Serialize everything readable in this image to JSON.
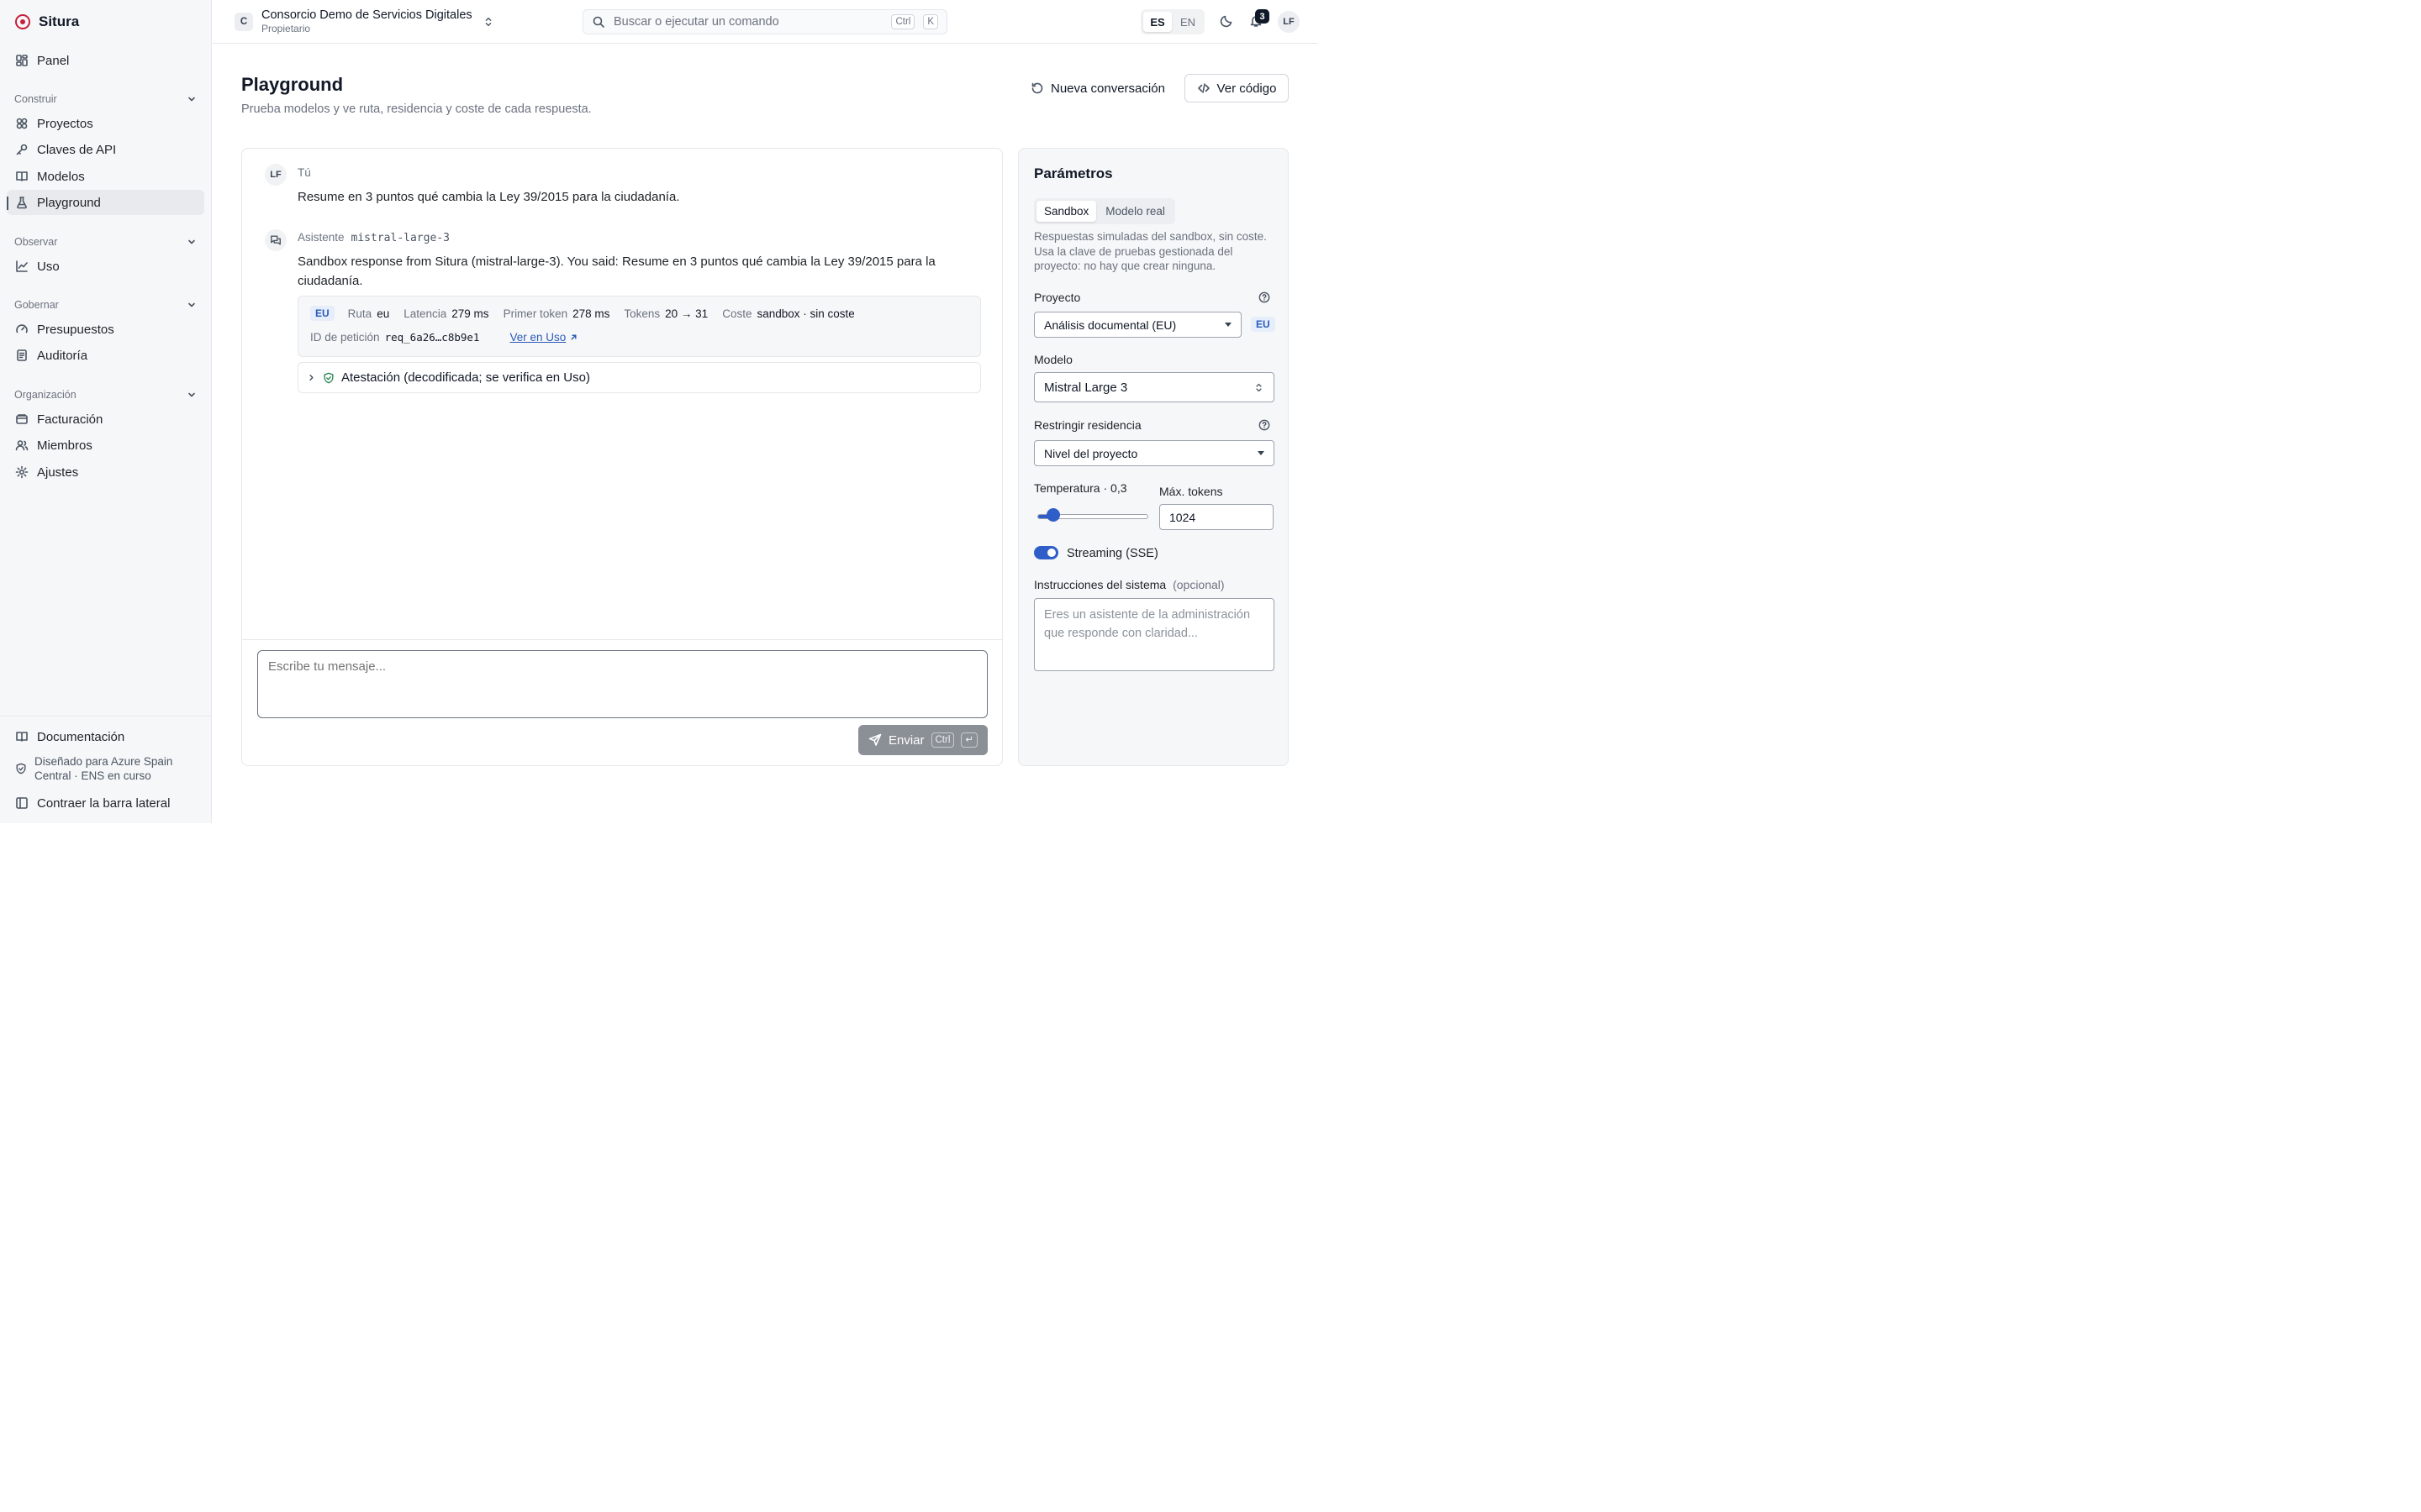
{
  "app": {
    "brand": "Situra"
  },
  "sidebar": {
    "top_item": "Panel",
    "sections": [
      {
        "title": "Construir",
        "items": [
          "Proyectos",
          "Claves de API",
          "Modelos",
          "Playground"
        ]
      },
      {
        "title": "Observar",
        "items": [
          "Uso"
        ]
      },
      {
        "title": "Gobernar",
        "items": [
          "Presupuestos",
          "Auditoría"
        ]
      },
      {
        "title": "Organización",
        "items": [
          "Facturación",
          "Miembros",
          "Ajustes"
        ]
      }
    ],
    "active": "Playground",
    "docs": "Documentación",
    "footnote_line1": "Diseñado para Azure Spain",
    "footnote_line2": "Central · ENS en curso",
    "collapse": "Contraer la barra lateral"
  },
  "topbar": {
    "org_initial": "C",
    "org_name": "Consorcio Demo de Servicios Digitales",
    "org_role": "Propietario",
    "search_placeholder": "Buscar o ejecutar un comando",
    "search_kbd_1": "Ctrl",
    "search_kbd_2": "K",
    "lang_es": "ES",
    "lang_en": "EN",
    "notifications_count": "3",
    "user_initials": "LF"
  },
  "page": {
    "title": "Playground",
    "subtitle": "Prueba modelos y ve ruta, residencia y coste de cada respuesta.",
    "new_conversation": "Nueva conversación",
    "view_code": "Ver código"
  },
  "chat": {
    "user_initials": "LF",
    "user_role": "Tú",
    "user_message": "Resume en 3 puntos qué cambia la Ley 39/2015 para la ciudadanía.",
    "assistant_role": "Asistente",
    "assistant_model": "mistral-large-3",
    "assistant_line1": "Sandbox response from Situra (mistral-large-3). You said: Resume en 3 puntos qué cambia la Ley 39/2015 para la",
    "assistant_line2": "ciudadanía.",
    "meta": {
      "region_tag": "EU",
      "route_label": "Ruta",
      "route_value": "eu",
      "latency_label": "Latencia",
      "latency_value": "279 ms",
      "first_token_label": "Primer token",
      "first_token_value": "278 ms",
      "tokens_label": "Tokens",
      "tokens_value": "20 → 31",
      "cost_label": "Coste",
      "cost_value": "sandbox · sin coste",
      "request_id_label": "ID de petición",
      "request_id_value": "req_6a26…c8b9e1",
      "usage_link": "Ver en Uso"
    },
    "attestation": "Atestación (decodificada; se verifica en Uso)",
    "composer_placeholder": "Escribe tu mensaje...",
    "send_label": "Enviar",
    "send_kbd": "Ctrl"
  },
  "params": {
    "title": "Parámetros",
    "mode_sandbox": "Sandbox",
    "mode_real": "Modelo real",
    "mode_selected": "Sandbox",
    "description": "Respuestas simuladas del sandbox, sin coste. Usa la clave de pruebas gestionada del proyecto: no hay que crear ninguna.",
    "project_label": "Proyecto",
    "project_value": "Análisis documental (EU)",
    "project_region": "EU",
    "model_label": "Modelo",
    "model_value": "Mistral Large 3",
    "residency_label": "Restringir residencia",
    "residency_value": "Nivel del proyecto",
    "temperature_label": "Temperatura · 0,3",
    "temperature_value": 0.3,
    "max_tokens_label": "Máx. tokens",
    "max_tokens_value": "1024",
    "streaming_label": "Streaming (SSE)",
    "streaming_on": true,
    "system_label": "Instrucciones del sistema",
    "system_optional": "(opcional)",
    "system_placeholder": "Eres un asistente de la administración que responde con claridad..."
  },
  "colors": {
    "accent": "#2f5ec9",
    "brand": "#c81e3a",
    "eu_tag_bg": "#e6edfb",
    "eu_tag_text": "#2b5bb8"
  }
}
